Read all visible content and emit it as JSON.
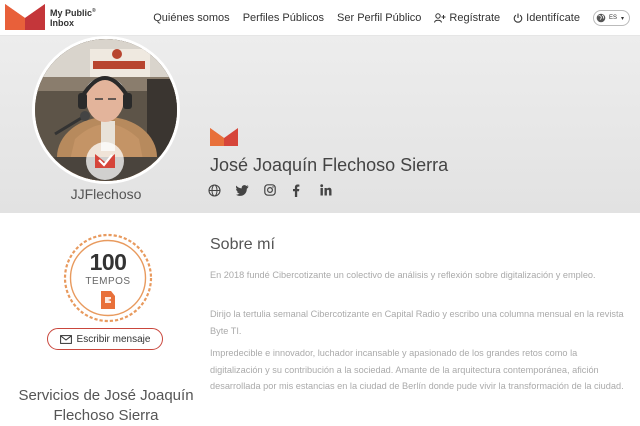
{
  "header": {
    "logo_line1": "My Public",
    "logo_reg": "®",
    "logo_line2": "Inbox",
    "nav": {
      "quienes": "Quiénes somos",
      "perfiles": "Perfiles Públicos",
      "ser_perfil": "Ser Perfil Público",
      "registrate": "Regístrate",
      "identificate": "Identifícate"
    },
    "language": "ES"
  },
  "profile": {
    "username": "JJFlechoso",
    "full_name": "José Joaquín Flechoso Sierra",
    "social_icons": [
      "globe-icon",
      "twitter-icon",
      "instagram-icon",
      "facebook-icon",
      "linkedin-icon"
    ]
  },
  "badge": {
    "number": "100",
    "label": "TEMPOS"
  },
  "write_button": "Escribir mensaje",
  "services_title": "Servicios de José Joaquín Flechoso Sierra",
  "about": {
    "title": "Sobre mí",
    "p1": "En 2018 fundé Cibercotizante un colectivo de análisis y reflexión sobre digitalización y empleo.",
    "p2": "Dirijo la tertulia semanal Cibercotizante en Capital Radio y escribo una columna mensual en la revista Byte TI.",
    "p3": "Impredecible e innovador, luchador incansable y apasionado de los grandes retos como la digitalización y su contribución a la sociedad.  Amante de la arquitectura contemporánea, afición desarrollada por mis estancias en la ciudad de Berlín donde pude vivir la transformación de la ciudad."
  },
  "colors": {
    "brand_red": "#d6453a",
    "brand_orange": "#e87a3a",
    "badge_orange": "#e89a5e"
  }
}
